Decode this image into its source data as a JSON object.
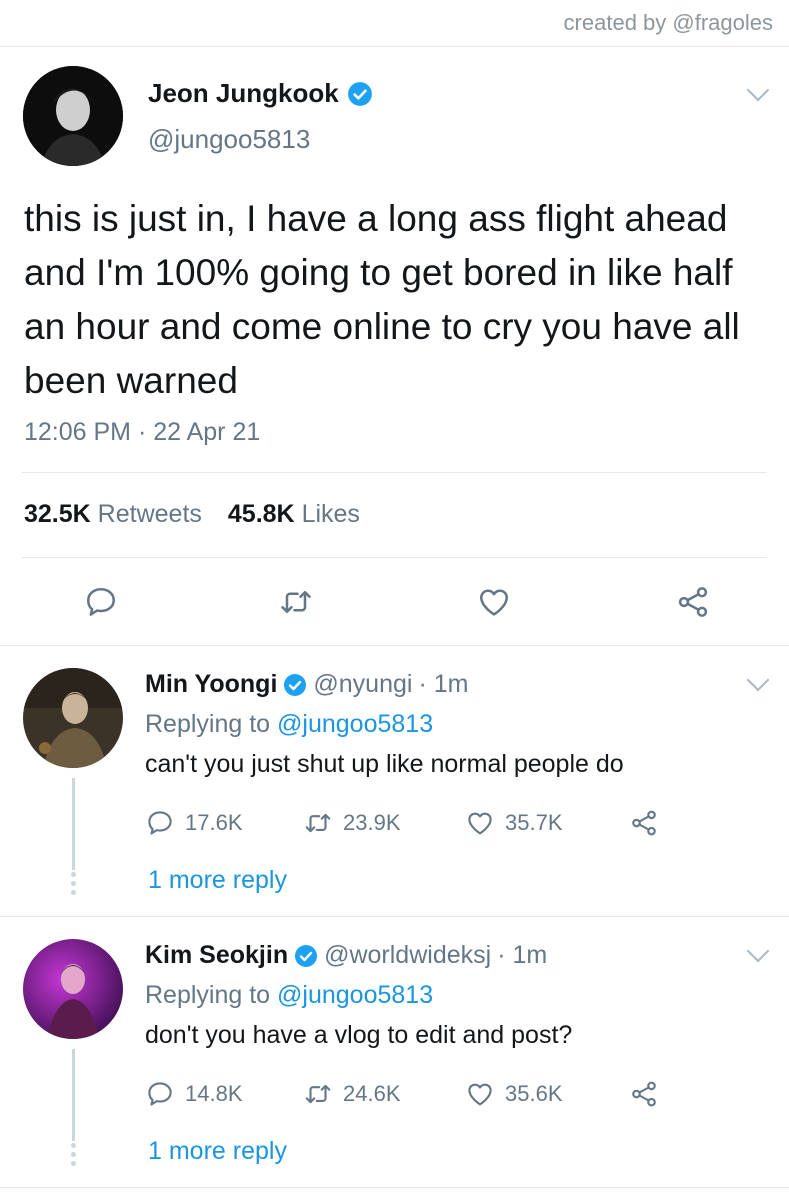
{
  "credit": "created by @fragoles",
  "main_tweet": {
    "display_name": "Jeon Jungkook",
    "handle": "@jungoo5813",
    "text": "this is just in, I have a long ass flight ahead and I'm 100% going to get bored in like half an hour and come online to cry you have all been warned",
    "timestamp": "12:06 PM · 22 Apr 21",
    "retweets_count": "32.5K",
    "retweets_label": "Retweets",
    "likes_count": "45.8K",
    "likes_label": "Likes"
  },
  "replies": [
    {
      "display_name": "Min Yoongi",
      "handle": "@nyungi",
      "time": "· 1m",
      "replying_label": "Replying to",
      "replying_to": "@jungoo5813",
      "text": "can't you just shut up like normal people do",
      "reply_count": "17.6K",
      "retweet_count": "23.9K",
      "like_count": "35.7K",
      "more_replies": "1 more reply"
    },
    {
      "display_name": "Kim Seokjin",
      "handle": "@worldwideksj",
      "time": "· 1m",
      "replying_label": "Replying to",
      "replying_to": "@jungoo5813",
      "text": "don't you have a vlog to edit and post?",
      "reply_count": "14.8K",
      "retweet_count": "24.6K",
      "like_count": "35.6K",
      "more_replies": "1 more reply"
    }
  ],
  "colors": {
    "link": "#1b95e0",
    "muted": "#657786",
    "verified": "#1da1f2",
    "divider": "#e1e8ed"
  },
  "icons": [
    "verified-badge-icon",
    "chevron-down-icon",
    "reply-icon",
    "retweet-icon",
    "like-icon",
    "share-icon"
  ]
}
